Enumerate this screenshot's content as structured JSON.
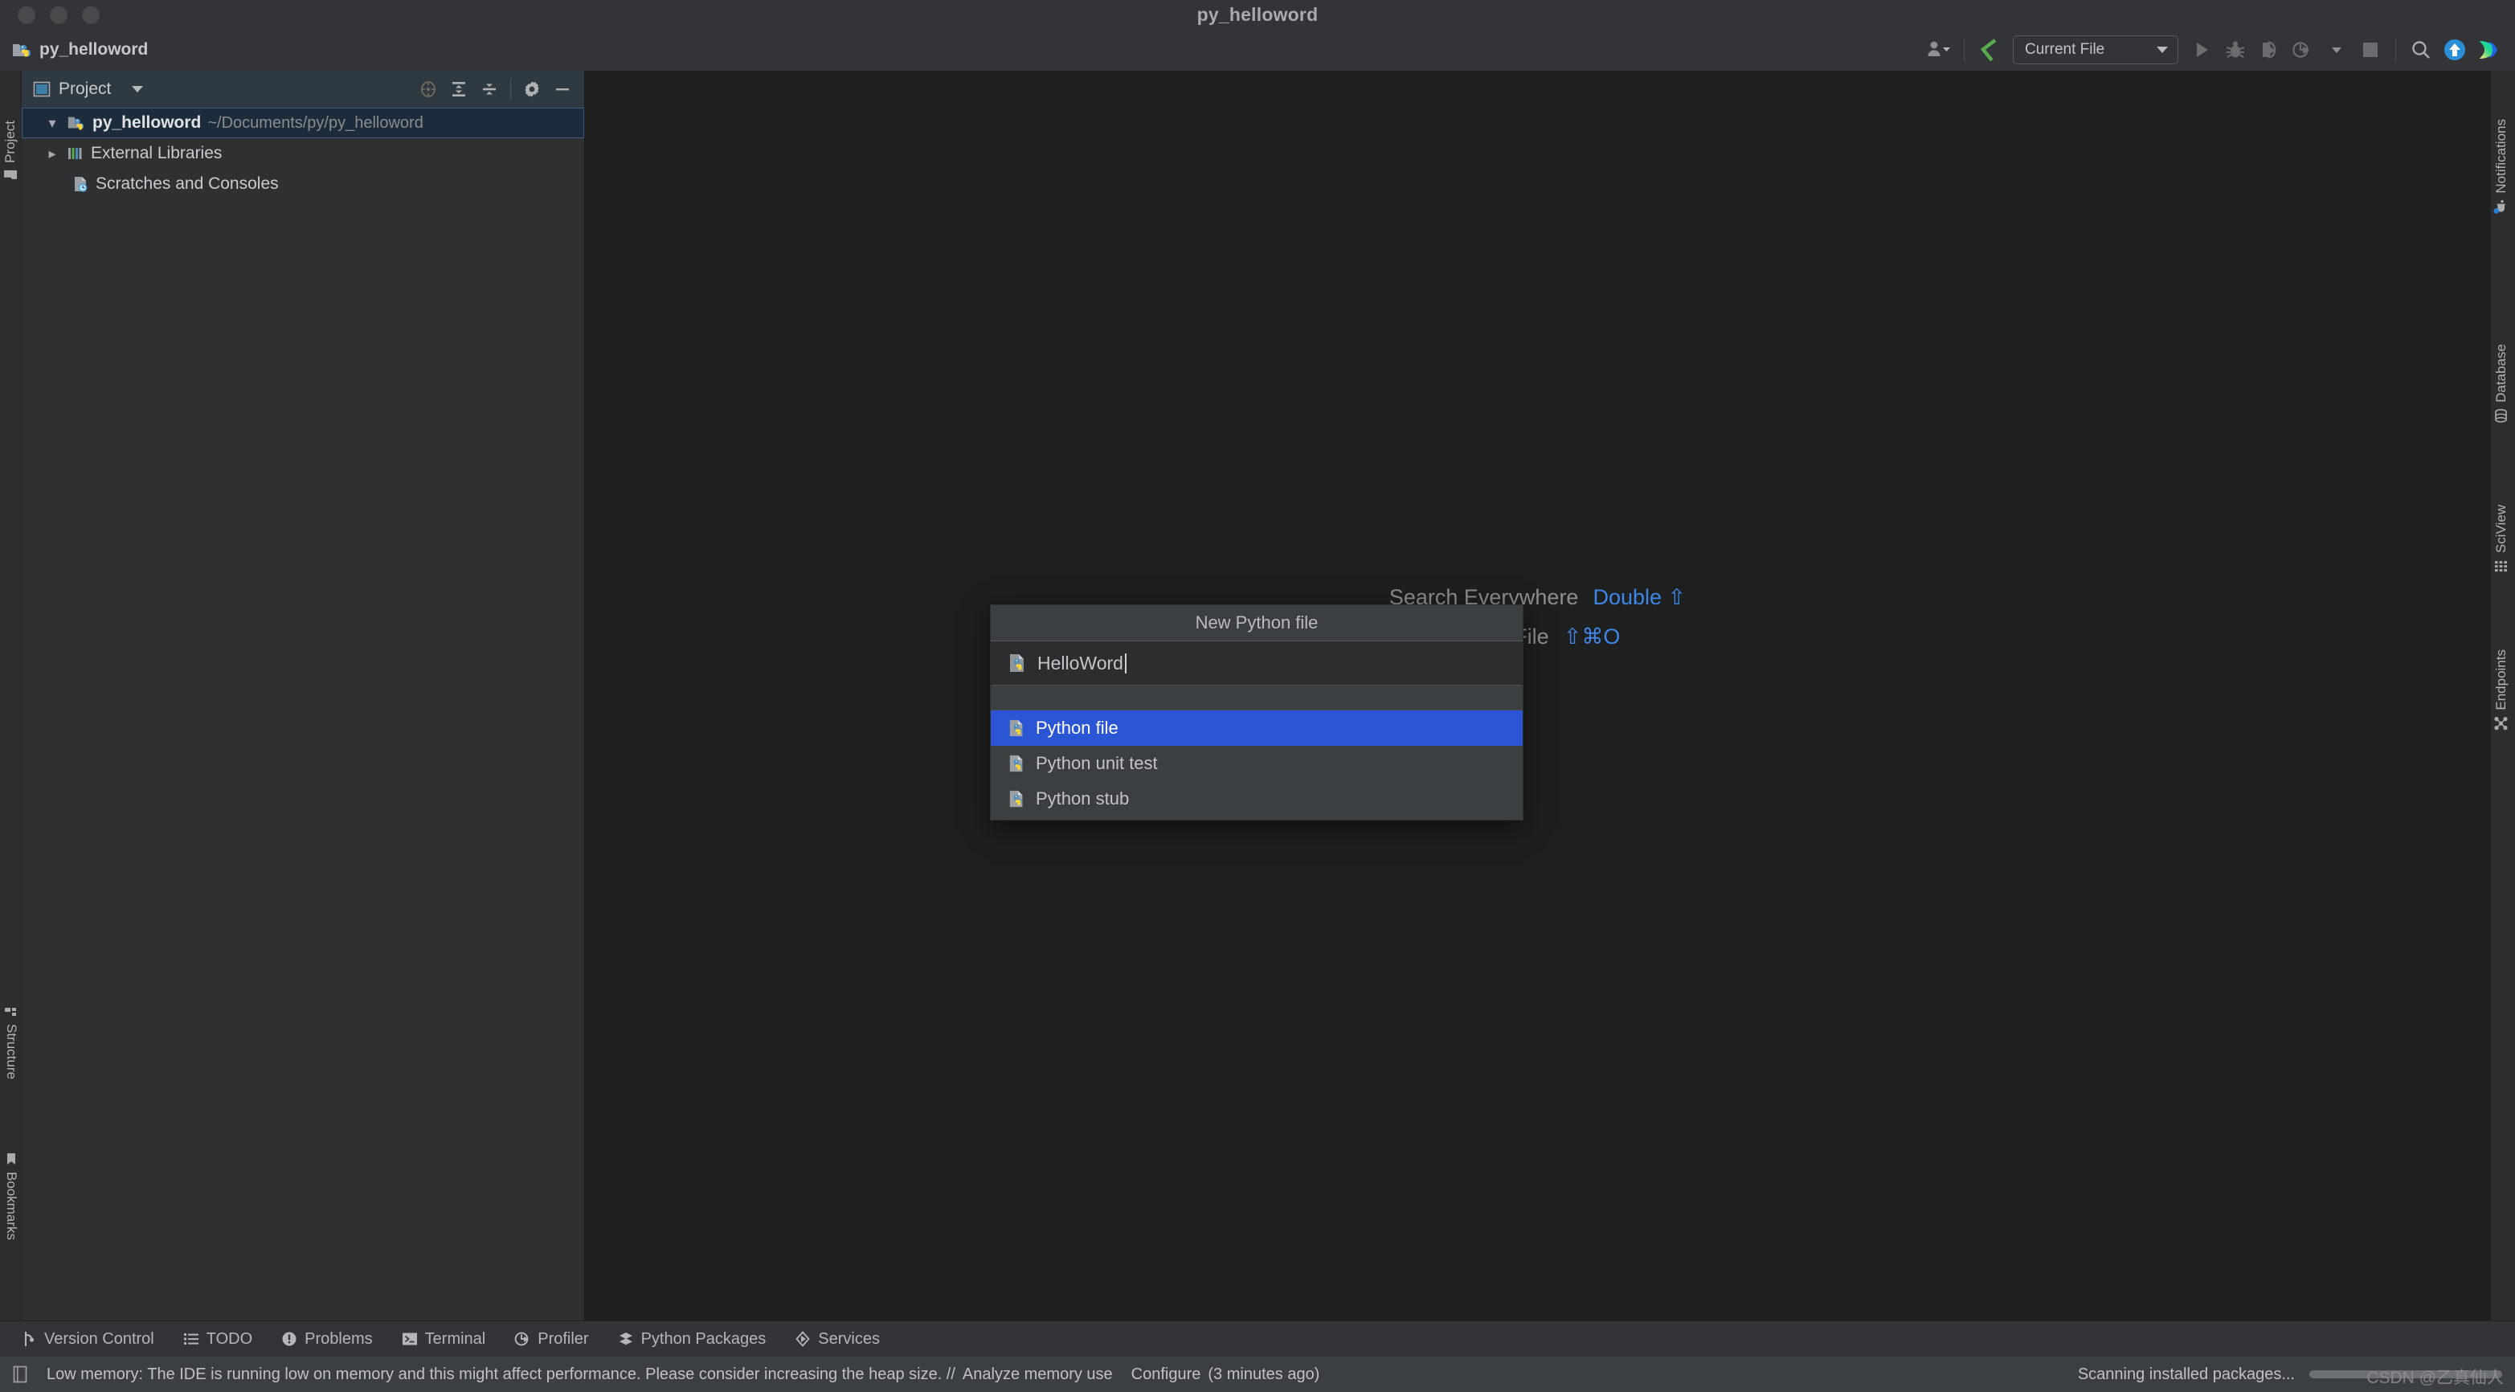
{
  "window": {
    "title": "py_helloword",
    "traffic_lights": [
      "close",
      "minimize",
      "zoom"
    ]
  },
  "toolbar": {
    "project_name": "py_helloword",
    "project_icon": "python-folder-icon",
    "account_icon": "user-account-icon",
    "vcs_update_icon": "vcs-commit-icon",
    "run_config": "Current File",
    "run_icon": "run-icon",
    "debug_icon": "debug-icon",
    "coverage_icon": "run-with-coverage-icon",
    "profile_icon": "profile-icon",
    "stop_icon": "stop-icon",
    "search_icon": "search-icon",
    "updates_icon": "update-available-icon",
    "ide_logo_icon": "pycharm-logo-icon"
  },
  "left_rail": {
    "tabs": [
      {
        "label": "Project",
        "icon": "project-folder-icon"
      },
      {
        "label": "Structure",
        "icon": "structure-icon"
      },
      {
        "label": "Bookmarks",
        "icon": "bookmarks-icon"
      }
    ]
  },
  "right_rail": {
    "tabs": [
      {
        "label": "Notifications",
        "icon": "notifications-bell-icon"
      },
      {
        "label": "Database",
        "icon": "database-icon"
      },
      {
        "label": "SciView",
        "icon": "sciview-grid-icon"
      },
      {
        "label": "Endpoints",
        "icon": "endpoints-icon"
      }
    ]
  },
  "project_panel": {
    "header": {
      "title": "Project",
      "view_icon": "project-view-icon",
      "dropdown_icon": "chevron-down-icon",
      "actions": [
        {
          "name": "select-opened-file",
          "icon": "target-icon"
        },
        {
          "name": "expand-all",
          "icon": "expand-all-icon"
        },
        {
          "name": "collapse-all",
          "icon": "collapse-all-icon"
        },
        {
          "name": "settings",
          "icon": "gear-icon"
        },
        {
          "name": "hide",
          "icon": "minus-icon"
        }
      ]
    },
    "tree": [
      {
        "label": "py_helloword",
        "path": "~/Documents/py/py_helloword",
        "icon": "python-project-folder-icon",
        "arrow": "expanded",
        "selected": true,
        "indent": false
      },
      {
        "label": "External Libraries",
        "path": "",
        "icon": "external-libraries-icon",
        "arrow": "collapsed",
        "selected": false,
        "indent": false
      },
      {
        "label": "Scratches and Consoles",
        "path": "",
        "icon": "scratches-icon",
        "arrow": "none",
        "selected": false,
        "indent": true
      }
    ]
  },
  "editor": {
    "hints": [
      {
        "label": "Search Everywhere",
        "shortcut": "Double ⇧"
      },
      {
        "label": "Go to File",
        "shortcut": "⇧⌘O"
      }
    ]
  },
  "popup": {
    "title": "New Python file",
    "input_value": "HelloWord",
    "input_icon": "python-file-icon",
    "options": [
      {
        "label": "Python file",
        "icon": "python-file-icon",
        "selected": true
      },
      {
        "label": "Python unit test",
        "icon": "python-file-icon",
        "selected": false
      },
      {
        "label": "Python stub",
        "icon": "python-file-icon",
        "selected": false
      }
    ],
    "selection_color": "#2a56d6"
  },
  "tool_window_bar": {
    "items": [
      {
        "label": "Version Control",
        "icon": "vcs-branch-icon"
      },
      {
        "label": "TODO",
        "icon": "todo-list-icon"
      },
      {
        "label": "Problems",
        "icon": "problems-icon"
      },
      {
        "label": "Terminal",
        "icon": "terminal-icon"
      },
      {
        "label": "Profiler",
        "icon": "profiler-icon"
      },
      {
        "label": "Python Packages",
        "icon": "python-packages-icon"
      },
      {
        "label": "Services",
        "icon": "services-icon"
      }
    ]
  },
  "status_bar": {
    "memory_icon": "memory-indicator-icon",
    "message": "Low memory: The IDE is running low on memory and this might affect performance. Please consider increasing the heap size. //",
    "action_analyze": "Analyze memory use",
    "action_configure": "Configure",
    "timestamp": "(3 minutes ago)",
    "background_task": "Scanning installed packages...",
    "watermark": "CSDN @乙真仙人"
  }
}
